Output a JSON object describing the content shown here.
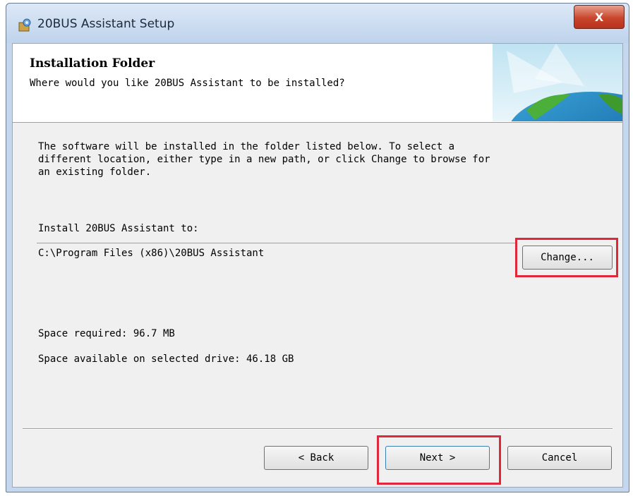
{
  "window": {
    "title": "20BUS Assistant Setup",
    "close_label": "X"
  },
  "banner": {
    "title": "Installation Folder",
    "subtitle": "Where would you like 20BUS Assistant to be installed?"
  },
  "body": {
    "description_lines": [
      "The software will be installed in the folder listed below. To select a",
      "different location, either type in a new path, or click Change to browse for",
      "an existing folder."
    ],
    "install_to_label": "Install 20BUS Assistant to:",
    "install_path": "C:\\Program Files (x86)\\20BUS Assistant",
    "change_button": "Change...",
    "space_required": "Space required: 96.7 MB",
    "space_available": "Space available on selected drive: 46.18 GB"
  },
  "footer": {
    "back_button": "< Back",
    "next_button": "Next >",
    "cancel_button": "Cancel"
  },
  "colors": {
    "highlight": "#e0283a",
    "title_bar": "#c4d7ee"
  }
}
